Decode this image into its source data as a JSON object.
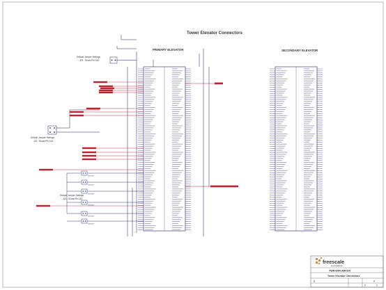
{
  "sheet": {
    "title": "Tower Elevator Connectors",
    "primary_label": "PRIMARY ELEVATOR",
    "secondary_label": "SECONDARY ELEVATOR"
  },
  "notes": [
    {
      "line1": "Default Jumper Settings",
      "line2": "- J23 - Shunt Pin 1&2"
    },
    {
      "line1": "Default Jumper Settings",
      "line2": "J12 - Shunt Pin 1&2"
    },
    {
      "line1": "Default Jumper Settings",
      "line2": "- J14 - Shunt Pin 1&2"
    }
  ],
  "title_block": {
    "brand": "freescale",
    "brand_sub": "semiconductor",
    "board": "TWR-WIFI-AR4100",
    "page_title": "Tower Elevator Connectors",
    "size": "B",
    "rev": "A",
    "sheet": "5",
    "of": "5"
  },
  "colors": {
    "wire": "#1a1a6e",
    "netlabel": "#c0202e",
    "frame": "#555555"
  }
}
